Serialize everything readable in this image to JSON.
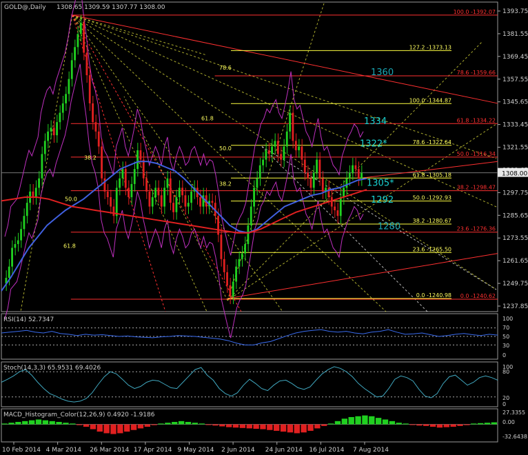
{
  "chart_data": {
    "type": "candlestick",
    "title": "GOLD@,Daily",
    "ohlc_header": "1308.65 1309.59 1307.77 1308.00",
    "main": {
      "ylim": [
        1234,
        1399
      ],
      "price_ticks": [
        "1393.75",
        "1381.55",
        "1369.45",
        "1357.55",
        "1345.65",
        "1333.45",
        "1321.55",
        "1309.65",
        "1297.75",
        "1285.65",
        "1273.55",
        "1261.65",
        "1249.75",
        "1237.85"
      ],
      "current_price": "1308.00",
      "date_ticks": [
        "10 Feb 2014",
        "4 Mar 2014",
        "26 Mar 2014",
        "17 Apr 2014",
        "9 May 2014",
        "2 Jun 2014",
        "24 Jun 2014",
        "16 Jul 2014",
        "7 Aug 2014"
      ],
      "fib_right": [
        {
          "text": "100.0 -1392.07",
          "value": 1392.07,
          "x1": 0.14,
          "color": "#ff3030"
        },
        {
          "text": "78.6 -1359.66",
          "value": 1359.66,
          "x1": 0.43,
          "color": "#ff3030"
        },
        {
          "text": "61.8 -1334.22",
          "value": 1334.22,
          "x1": 0.14,
          "color": "#ff3030"
        },
        {
          "text": "50.0 -1316.34",
          "value": 1316.34,
          "x1": 0.14,
          "color": "#ff3030"
        },
        {
          "text": "38.2 -1298.47",
          "value": 1298.47,
          "x1": 0.14,
          "color": "#ff3030"
        },
        {
          "text": "23.6 -1276.36",
          "value": 1276.36,
          "x1": 0.14,
          "color": "#ff3030"
        },
        {
          "text": "0.0 -1240.62",
          "value": 1240.62,
          "x1": 0.14,
          "color": "#ff3030"
        }
      ],
      "fib_mid": [
        {
          "text": "127.2 -1373.13",
          "value": 1373.13
        },
        {
          "text": "100.0 -1344.87",
          "value": 1344.87
        },
        {
          "text": "78.6 -1322.64",
          "value": 1322.64
        },
        {
          "text": "61.8 -1305.18",
          "value": 1305.18
        },
        {
          "text": "50.0 -1292.93",
          "value": 1292.93
        },
        {
          "text": "38.2 -1280.67",
          "value": 1280.67
        },
        {
          "text": "23.6 -1265.50",
          "value": 1265.5
        },
        {
          "text": "0.0 -1240.98",
          "value": 1240.98
        }
      ],
      "fan_labels_left": [
        {
          "text": "78.6",
          "value": 1363
        },
        {
          "text": "61.8",
          "value": 1336
        },
        {
          "text": "50.0",
          "value": 1320
        },
        {
          "text": "38.2",
          "value": 1315
        },
        {
          "text": "38.2",
          "value": 1301
        },
        {
          "text": "50.0",
          "value": 1293
        },
        {
          "text": "61.8",
          "value": 1268
        }
      ],
      "annotations": [
        {
          "text": "1360",
          "value": 1360,
          "color": "#19a7b4"
        },
        {
          "text": "1334",
          "value": 1334,
          "color": "#19d2d2"
        },
        {
          "text": "1322*",
          "value": 1322,
          "color": "#19d2d2"
        },
        {
          "text": "1305*",
          "value": 1301,
          "color": "#19d2d2"
        },
        {
          "text": "1292",
          "value": 1292,
          "color": "#19d2d2"
        },
        {
          "text": "1280",
          "value": 1278,
          "color": "#19a7b4"
        }
      ],
      "series": [
        {
          "name": "close",
          "values": [
            1252,
            1258,
            1268,
            1270,
            1272,
            1278,
            1285,
            1292,
            1298,
            1295,
            1300,
            1305,
            1318,
            1325,
            1330,
            1332,
            1328,
            1335,
            1340,
            1345,
            1350,
            1358,
            1368,
            1375,
            1382,
            1388,
            1372,
            1360,
            1345,
            1335,
            1330,
            1322,
            1305,
            1298,
            1295,
            1290,
            1285,
            1300,
            1305,
            1310,
            1300,
            1295,
            1302,
            1310,
            1320,
            1315,
            1305,
            1298,
            1290,
            1295,
            1300,
            1296,
            1290,
            1300,
            1305,
            1292,
            1287,
            1295,
            1300,
            1296,
            1290,
            1292,
            1298,
            1300,
            1295,
            1290,
            1296,
            1290,
            1293,
            1292,
            1285,
            1275,
            1262,
            1255,
            1248,
            1242,
            1250,
            1258,
            1262,
            1265,
            1270,
            1280,
            1290,
            1300,
            1305,
            1312,
            1315,
            1320,
            1318,
            1322,
            1325,
            1318,
            1315,
            1322,
            1330,
            1340,
            1325,
            1320,
            1322,
            1315,
            1308,
            1305,
            1300,
            1308,
            1315,
            1305,
            1298,
            1300,
            1295,
            1290,
            1288,
            1285,
            1295,
            1300,
            1305,
            1308,
            1312,
            1310,
            1305,
            1308
          ]
        },
        {
          "name": "ma_blue",
          "values": [
            1245,
            1252,
            1260,
            1268,
            1274,
            1280,
            1284,
            1288,
            1291,
            1294,
            1298,
            1302,
            1306,
            1310,
            1312,
            1314,
            1314,
            1313,
            1311,
            1309,
            1305,
            1300,
            1295,
            1290,
            1285,
            1280,
            1277,
            1276,
            1278,
            1282,
            1286,
            1290,
            1292,
            1294,
            1296,
            1297,
            1299,
            1300,
            1302,
            1304,
            1305
          ]
        },
        {
          "name": "ma_red",
          "values": [
            1293,
            1294,
            1295,
            1295,
            1294,
            1292,
            1290,
            1289,
            1288,
            1287,
            1286,
            1285,
            1284,
            1283,
            1282,
            1281,
            1280,
            1279,
            1278,
            1277,
            1276,
            1276,
            1278,
            1281,
            1284,
            1287,
            1289,
            1291,
            1293,
            1295,
            1297,
            1299
          ]
        }
      ]
    },
    "rsi": {
      "label": "RSI(14) 52.7347",
      "ylim": [
        0,
        100
      ],
      "ticks": [
        "100",
        "70",
        "50",
        "30",
        "0"
      ],
      "values": [
        58,
        60,
        62,
        64,
        60,
        58,
        62,
        57,
        55,
        52,
        55,
        53,
        54,
        52,
        50,
        51,
        49,
        48,
        47,
        49,
        50,
        52,
        51,
        50,
        48,
        46,
        44,
        40,
        34,
        30,
        30,
        35,
        38,
        45,
        52,
        58,
        62,
        64,
        66,
        62,
        60,
        62,
        58,
        56,
        60,
        62,
        66,
        60,
        55,
        56,
        58,
        54,
        50,
        52,
        55,
        57,
        54,
        52,
        55,
        53
      ]
    },
    "stoch": {
      "label": "Stoch(14,3,3) 65.9531 69.4026",
      "ylim": [
        0,
        100
      ],
      "ticks": [
        "100",
        "80",
        "20",
        "0"
      ],
      "values": [
        55,
        62,
        70,
        80,
        85,
        72,
        55,
        40,
        28,
        22,
        15,
        10,
        8,
        10,
        16,
        30,
        50,
        68,
        80,
        75,
        62,
        48,
        40,
        45,
        55,
        60,
        58,
        50,
        42,
        40,
        55,
        70,
        85,
        90,
        72,
        60,
        40,
        28,
        22,
        30,
        48,
        62,
        52,
        40,
        35,
        48,
        58,
        60,
        52,
        42,
        38,
        44,
        60,
        75,
        85,
        92,
        88,
        80,
        68,
        52,
        40,
        30,
        20,
        22,
        40,
        62,
        70,
        66,
        58,
        38,
        22,
        18,
        28,
        52,
        68,
        72,
        60,
        48,
        55,
        66,
        70,
        66,
        60
      ]
    },
    "macd": {
      "label": "MACD_Histogram_Color(12,26,9) 0.4920 -1.9186",
      "ylim": [
        -40,
        35
      ],
      "ticks": [
        "27.3355",
        "0.00",
        "-32.6438"
      ],
      "hist": [
        2,
        4,
        6,
        8,
        10,
        12,
        10,
        8,
        6,
        4,
        2,
        -2,
        -6,
        -12,
        -18,
        -22,
        -24,
        -22,
        -18,
        -14,
        -10,
        -6,
        -2,
        2,
        4,
        6,
        8,
        6,
        4,
        2,
        -1,
        -3,
        -5,
        -7,
        -8,
        -9,
        -10,
        -11,
        -12,
        -14,
        -16,
        -18,
        -20,
        -22,
        -20,
        -16,
        -10,
        -4,
        2,
        8,
        14,
        18,
        20,
        22,
        20,
        16,
        12,
        8,
        4,
        2,
        -1,
        -3,
        -4,
        -6,
        -8,
        -7,
        -6,
        -4,
        -2,
        2,
        3,
        4,
        5
      ]
    }
  }
}
